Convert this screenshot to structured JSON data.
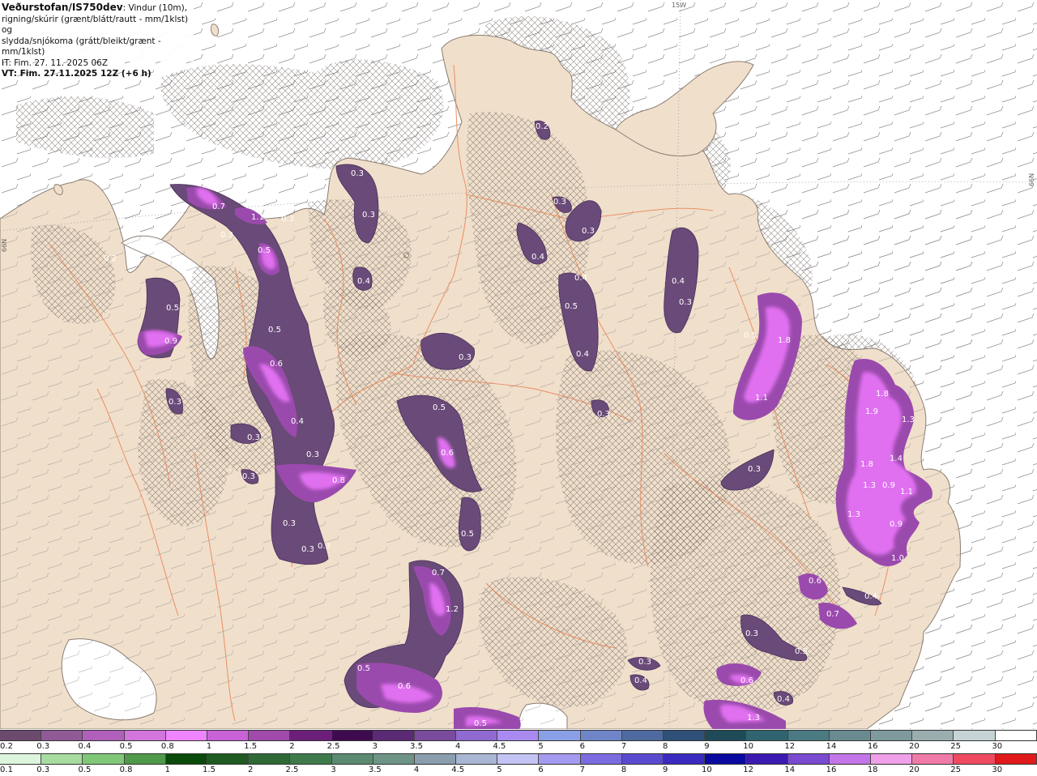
{
  "header": {
    "brand": "Veðurstofan/IS750dev",
    "line1_rest": ": Vindur (10m),",
    "line2": "rigning/skúrir (grænt/blátt/rautt - mm/1klst) og",
    "line3": "slydda/snjókoma (grátt/bleikt/grænt - mm/1klst)",
    "issue_time": "IT: Fim. 27. 11. 2025 06Z",
    "valid_time": "VT: Fim. 27.11.2025 12Z (+6 h)"
  },
  "grid_labels": {
    "meridian": "15W",
    "parallel_right": "66N",
    "parallel_left": "66N"
  },
  "colors": {
    "sea": "#ffffff",
    "land": "#f0dfcb",
    "sea_ice_hatch": "#7a6f6a",
    "roads": "#e8875a",
    "precip_light": "#6a4a78",
    "precip_mid": "#9a4aac",
    "precip_heavy": "#e070f0"
  },
  "precip_values": [
    "0.2",
    "0.3",
    "0.3",
    "0.3",
    "0.7",
    "1.1",
    "0.3",
    "0.5",
    "0.2",
    "0.4",
    "0.4",
    "0.3",
    "0.3",
    "0.5",
    "0.9",
    "0.3",
    "0.3",
    "0.5",
    "0.6",
    "0.4",
    "0.3",
    "0.3",
    "0.8",
    "0.3",
    "0.3",
    "0.3",
    "0.3",
    "0.5",
    "0.6",
    "0.5",
    "0.4",
    "0.5",
    "0.4",
    "0.4",
    "0.3",
    "0.3",
    "0.5",
    "1.8",
    "1.1",
    "0.3",
    "1.8",
    "1.9",
    "1.3",
    "1.8",
    "1.4",
    "1.3",
    "0.9",
    "1.1",
    "1.3",
    "0.9",
    "1.0",
    "0.6",
    "0.4",
    "0.7",
    "0.3",
    "0.5",
    "0.3",
    "0.4",
    "0.6",
    "0.4",
    "1.3",
    "0.7",
    "1.2",
    "0.5",
    "0.6",
    "0.5"
  ],
  "legend_snow": {
    "labels": [
      "0.2",
      "0.3",
      "0.4",
      "0.5",
      "0.8",
      "1",
      "1.5",
      "2",
      "2.5",
      "3",
      "3.5",
      "4",
      "4.5",
      "5",
      "6",
      "7",
      "8",
      "9",
      "10",
      "12",
      "14",
      "16",
      "20",
      "25",
      "30"
    ],
    "colors": [
      "#6b4a6e",
      "#8f5a96",
      "#b05fba",
      "#d276dd",
      "#ee84ff",
      "#c862d6",
      "#a04aac",
      "#6b1f78",
      "#3f0a4f",
      "#5a2a74",
      "#7a4b9c",
      "#8f6ad0",
      "#a88af0",
      "#8aa0e6",
      "#6f85c8",
      "#4f6aa0",
      "#2f5078",
      "#1f4a58",
      "#2f6470",
      "#4a7a82",
      "#6a8a90",
      "#7f9a9e",
      "#9aaeb0",
      "#c6d4d6",
      "#ffffff"
    ]
  },
  "legend_rain": {
    "labels": [
      "0.1",
      "0.3",
      "0.5",
      "0.8",
      "1",
      "1.5",
      "2",
      "2.5",
      "3",
      "3.5",
      "4",
      "4.5",
      "5",
      "6",
      "7",
      "8",
      "9",
      "10",
      "12",
      "14",
      "16",
      "18",
      "20",
      "25",
      "30"
    ],
    "colors": [
      "#dcf5dc",
      "#a8dba0",
      "#80c878",
      "#4f9a4a",
      "#0a4a0a",
      "#1e5a22",
      "#2f6a36",
      "#3f7a4c",
      "#5a8a70",
      "#6e9486",
      "#8a9eae",
      "#a9b6d4",
      "#c4c4f4",
      "#a49af0",
      "#7a6ce0",
      "#5a4ad0",
      "#3a2ac0",
      "#0a0aa0",
      "#3a1ab0",
      "#7a4ad0",
      "#c476e8",
      "#f0a0e8",
      "#f07aa8",
      "#f04a60",
      "#e01a1a"
    ]
  }
}
